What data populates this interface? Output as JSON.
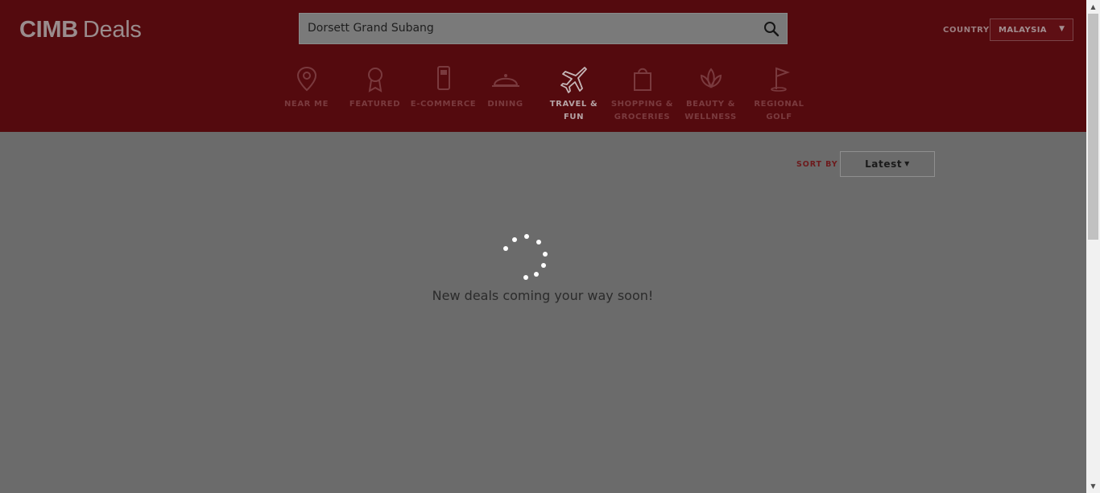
{
  "brand": {
    "name_bold": "CIMB",
    "name_light": "Deals"
  },
  "search": {
    "value": "Dorsett Grand Subang",
    "icon": "magnifier-icon"
  },
  "country": {
    "label": "COUNTRY",
    "selected": "MALAYSIA"
  },
  "nav": {
    "items": [
      {
        "label": "NEAR ME",
        "icon": "location-pin-icon"
      },
      {
        "label": "FEATURED",
        "icon": "award-ribbon-icon"
      },
      {
        "label": "E-COMMERCE",
        "icon": "mobile-phone-icon"
      },
      {
        "label": "DINING",
        "icon": "dining-cloche-icon"
      },
      {
        "label": "TRAVEL & FUN",
        "icon": "airplane-icon",
        "active": true
      },
      {
        "label": "SHOPPING & GROCERIES",
        "icon": "shopping-bag-icon"
      },
      {
        "label": "BEAUTY & WELLNESS",
        "icon": "lotus-icon"
      },
      {
        "label": "REGIONAL GOLF",
        "icon": "golf-flag-icon"
      }
    ]
  },
  "sort": {
    "label": "SORT BY",
    "value": "Latest"
  },
  "loading": {
    "message": "New deals coming your way soon!"
  },
  "colors": {
    "header_bg": "#540a0e",
    "overlay_bg": "#6b6b6b",
    "accent": "#6d1a1c"
  }
}
